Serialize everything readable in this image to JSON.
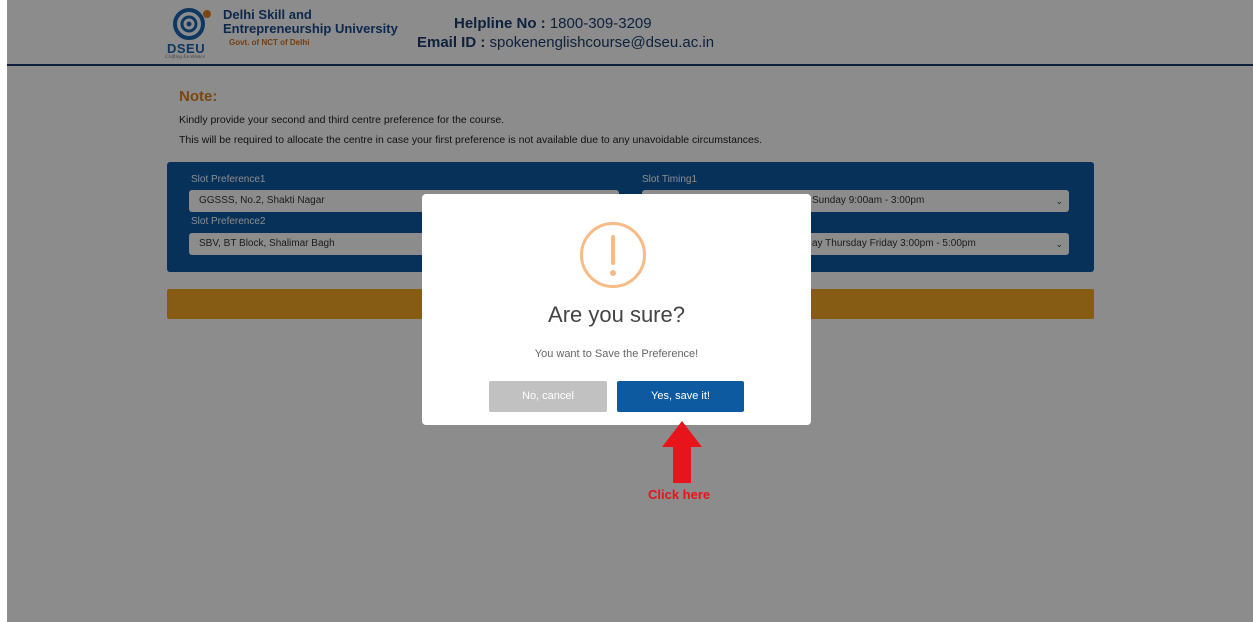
{
  "header": {
    "logo_text": "DSEU",
    "logo_tagline": "Crafting Excellence",
    "university_line1": "Delhi Skill and",
    "university_line2": "Entrepreneurship University",
    "university_sub": "Govt. of NCT of Delhi",
    "helpline_label": "Helpline No :",
    "helpline_value": "1800-309-3209",
    "email_label": "Email ID :",
    "email_value": "spokenenglishcourse@dseu.ac.in"
  },
  "note": {
    "title": "Note:",
    "line1": "Kindly provide your second and third centre preference for the course.",
    "line2": "This will be required to allocate the centre in case your first preference is not available due to any unavoidable circumstances."
  },
  "form": {
    "slot_pref1_label": "Slot Preference1",
    "slot_pref1_value": "GGSSS, No.2, Shakti Nagar",
    "slot_timing1_label": "Slot Timing1",
    "slot_timing1_value": "Sunday 9:00am - 3:00pm",
    "slot_pref2_label": "Slot Preference2",
    "slot_pref2_value": "SBV, BT Block, Shalimar Bagh",
    "slot_timing2_value": "ay Thursday Friday 3:00pm - 5:00pm"
  },
  "modal": {
    "title": "Are you sure?",
    "text": "You want to Save the Preference!",
    "cancel_label": "No, cancel",
    "confirm_label": "Yes, save it!"
  },
  "annotation": {
    "text": "Click here",
    "color": "#e8141b"
  },
  "colors": {
    "brand_blue": "#0d5aa0",
    "accent_orange": "#f5a623",
    "warning": "#f8bb86"
  }
}
